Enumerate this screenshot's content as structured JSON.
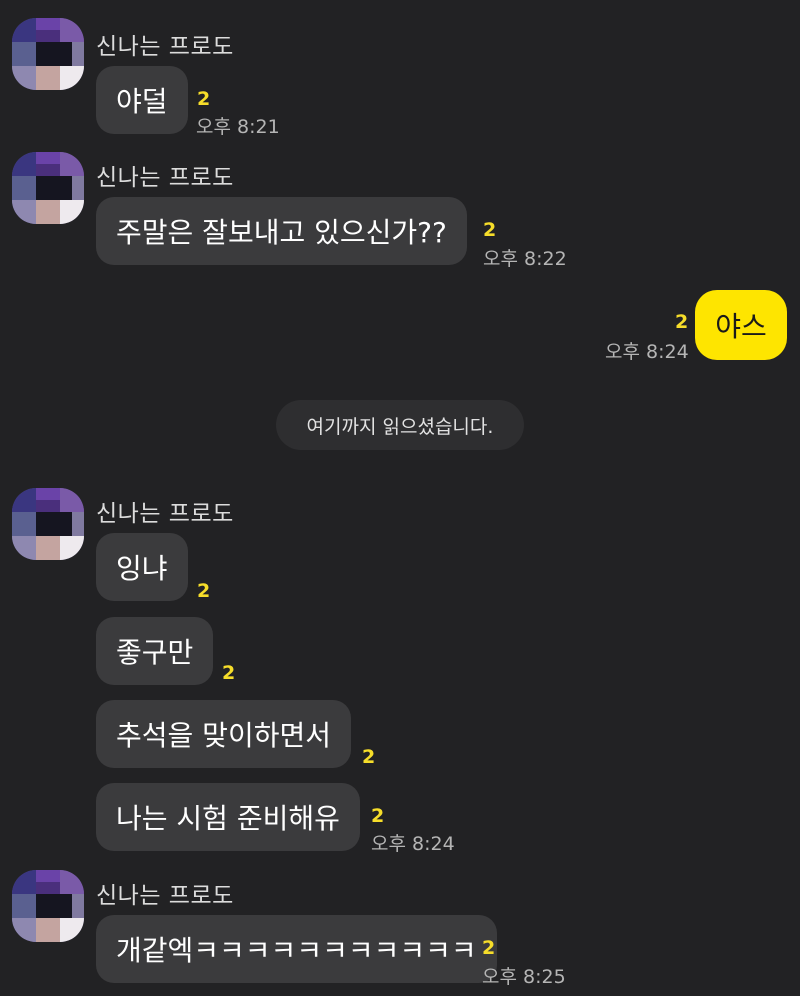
{
  "chat": {
    "friend_name": "신나는 프로도",
    "divider_text": "여기까지 읽으셨습니다.",
    "messages": [
      {
        "text": "야덜",
        "unread": "2",
        "time": "오후 8:21"
      },
      {
        "text": "주말은 잘보내고 있으신가??",
        "unread": "2",
        "time": "오후 8:22"
      },
      {
        "text": "야스",
        "unread": "2",
        "time": "오후 8:24"
      },
      {
        "text": "잉냐",
        "unread": "2"
      },
      {
        "text": "좋구만",
        "unread": "2"
      },
      {
        "text": "추석을 맞이하면서",
        "unread": "2"
      },
      {
        "text": "나는 시험 준비해유",
        "unread": "2",
        "time": "오후 8:24"
      },
      {
        "text": "개같엑ㅋㅋㅋㅋㅋㅋㅋㅋㅋㅋㅋ",
        "unread": "2",
        "time": "오후 8:25"
      }
    ]
  },
  "colors": {
    "background": "#222224",
    "friend_bubble": "#3b3b3d",
    "my_bubble": "#fee500",
    "unread_count": "#f6dd2a"
  }
}
